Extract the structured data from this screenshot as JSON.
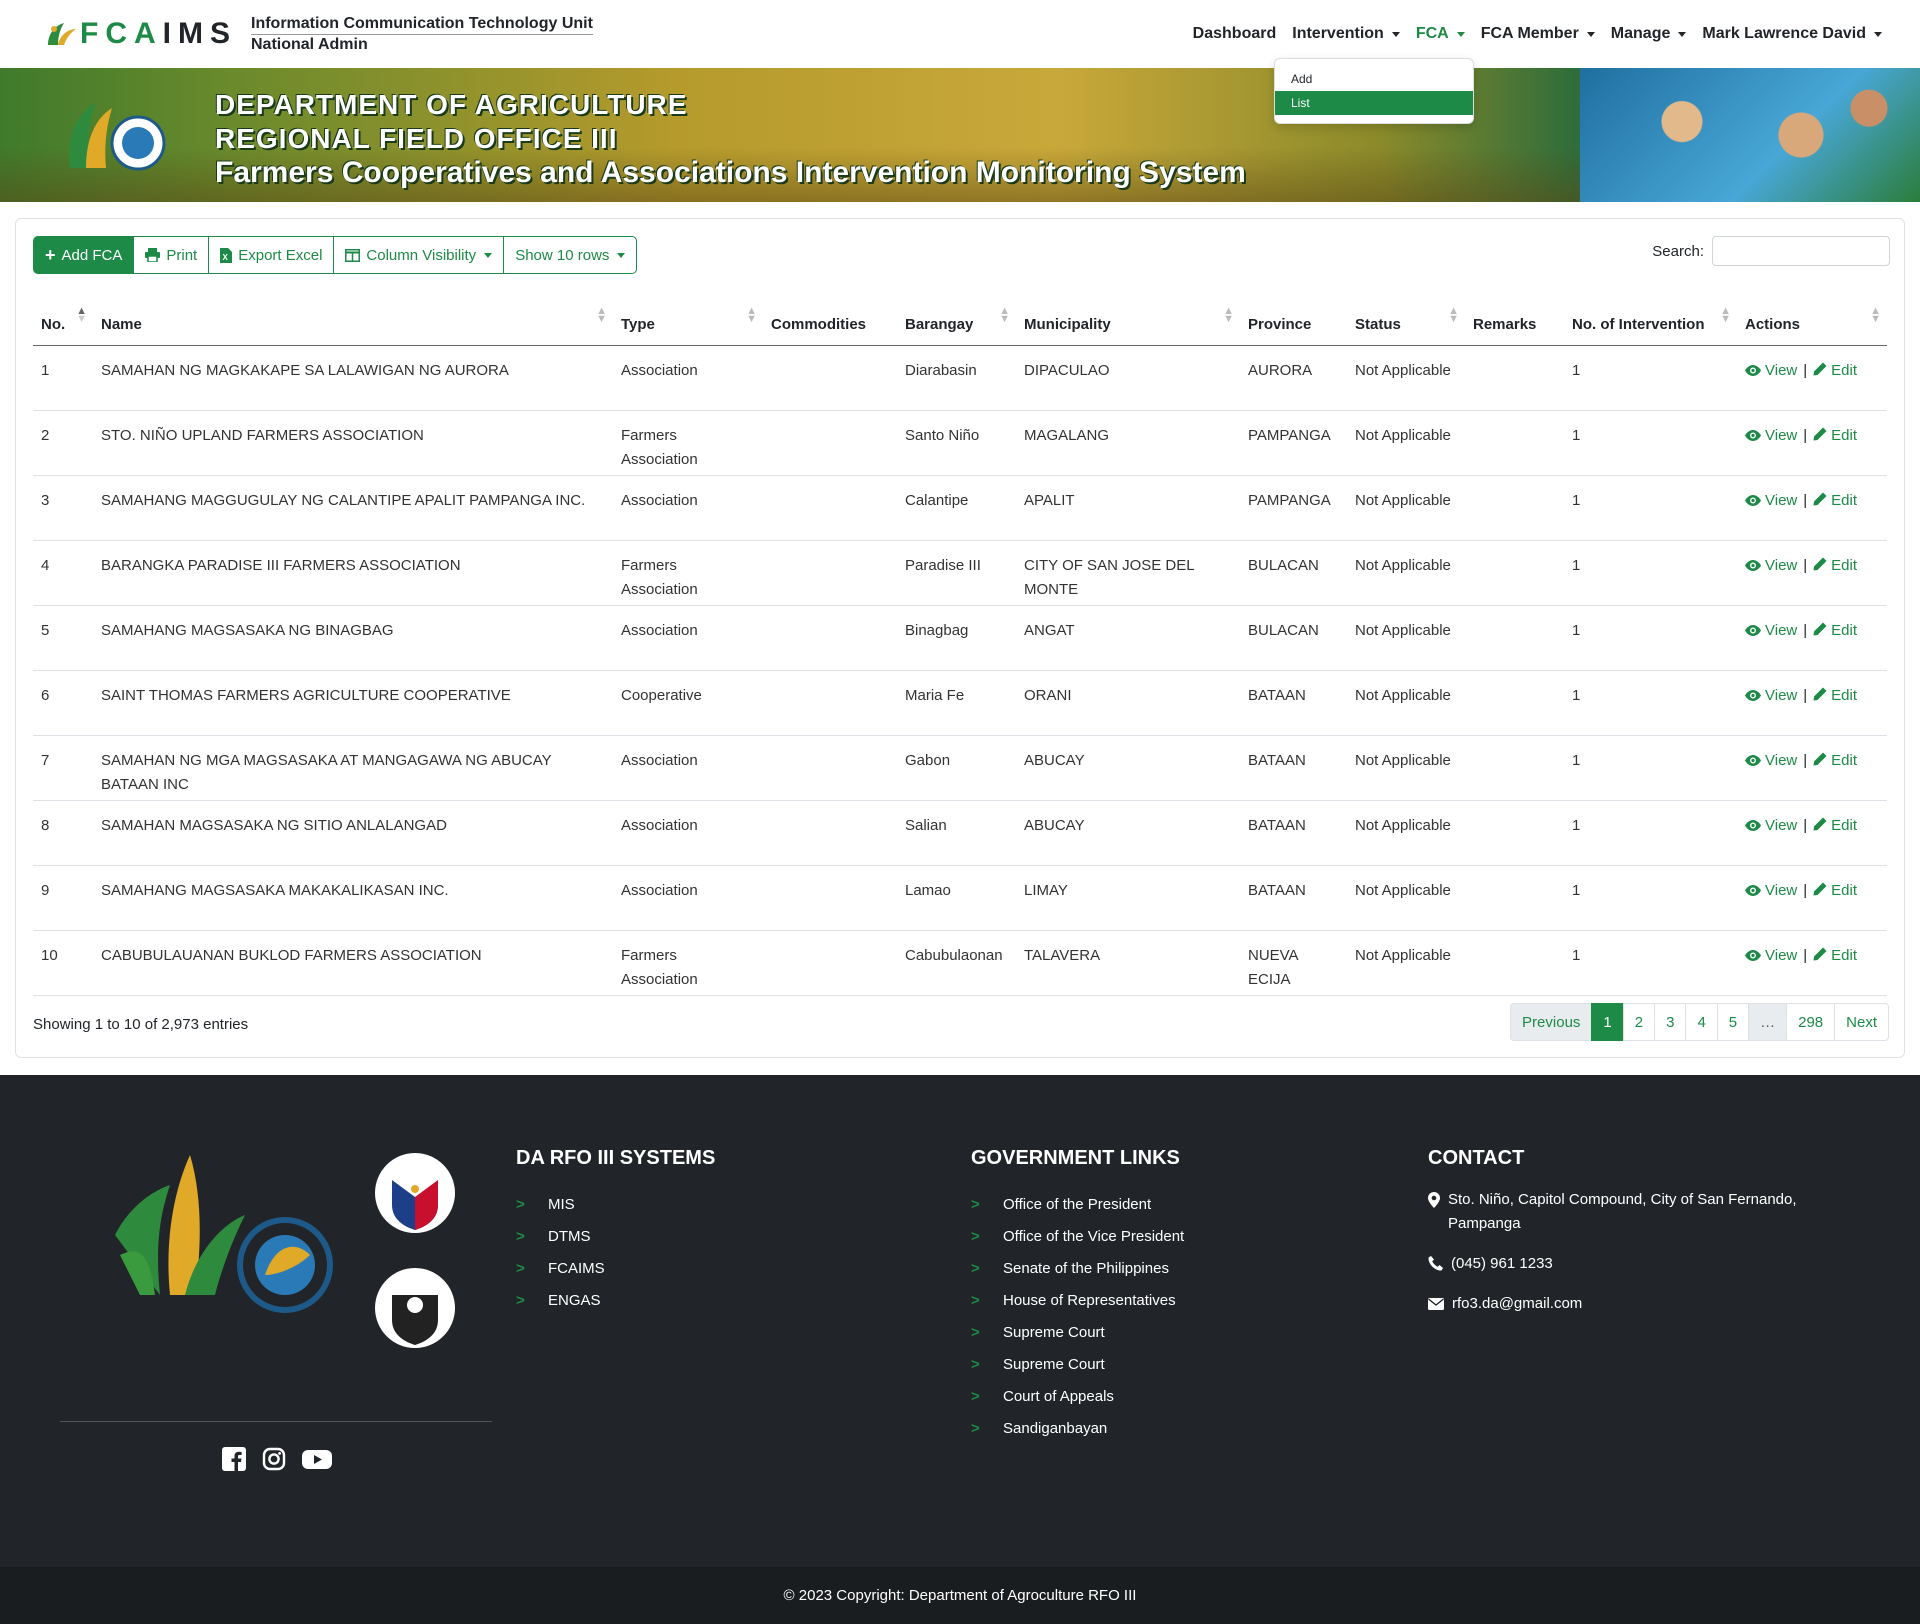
{
  "brand": {
    "name_fca": "FCA",
    "name_ims": "IMS",
    "unit": "Information Communication Technology Unit",
    "role": "National Admin"
  },
  "nav": {
    "items": [
      {
        "label": "Dashboard",
        "dropdown": false
      },
      {
        "label": "Intervention",
        "dropdown": true
      },
      {
        "label": "FCA",
        "dropdown": true,
        "active": true
      },
      {
        "label": "FCA Member",
        "dropdown": true
      },
      {
        "label": "Manage",
        "dropdown": true
      },
      {
        "label": "Mark Lawrence David",
        "dropdown": true
      }
    ],
    "fca_menu": [
      "Add",
      "List"
    ],
    "selected_menu": "List"
  },
  "banner": {
    "line1": "DEPARTMENT OF AGRICULTURE",
    "line2": "REGIONAL FIELD OFFICE III",
    "line3": "Farmers Cooperatives and Associations Intervention Monitoring System"
  },
  "toolbar": {
    "add_label": "Add FCA",
    "print_label": "Print",
    "export_label": "Export Excel",
    "columns_label": "Column Visibility",
    "rows_label": "Show 10 rows"
  },
  "search": {
    "label": "Search:",
    "value": ""
  },
  "table": {
    "headers": [
      "No.",
      "Name",
      "Type",
      "Commodities",
      "Barangay",
      "Municipality",
      "Province",
      "Status",
      "Remarks",
      "No. of Intervention",
      "Actions"
    ],
    "rows": [
      {
        "no": "1",
        "name": "SAMAHAN NG MAGKAKAPE SA LALAWIGAN NG AURORA",
        "type": "Association",
        "commodities": "",
        "barangay": "Diarabasin",
        "municipality": "DIPACULAO",
        "province": "AURORA",
        "status": "Not Applicable",
        "remarks": "",
        "interventions": "1"
      },
      {
        "no": "2",
        "name": "STO. NIÑO UPLAND FARMERS ASSOCIATION",
        "type": "Farmers Association",
        "commodities": "",
        "barangay": "Santo Niño",
        "municipality": "MAGALANG",
        "province": "PAMPANGA",
        "status": "Not Applicable",
        "remarks": "",
        "interventions": "1"
      },
      {
        "no": "3",
        "name": "SAMAHANG MAGGUGULAY NG CALANTIPE APALIT PAMPANGA INC.",
        "type": "Association",
        "commodities": "",
        "barangay": "Calantipe",
        "municipality": "APALIT",
        "province": "PAMPANGA",
        "status": "Not Applicable",
        "remarks": "",
        "interventions": "1"
      },
      {
        "no": "4",
        "name": "BARANGKA PARADISE III FARMERS ASSOCIATION",
        "type": "Farmers Association",
        "commodities": "",
        "barangay": "Paradise III",
        "municipality": "CITY OF SAN JOSE DEL MONTE",
        "province": "BULACAN",
        "status": "Not Applicable",
        "remarks": "",
        "interventions": "1"
      },
      {
        "no": "5",
        "name": "SAMAHANG MAGSASAKA NG BINAGBAG",
        "type": "Association",
        "commodities": "",
        "barangay": "Binagbag",
        "municipality": "ANGAT",
        "province": "BULACAN",
        "status": "Not Applicable",
        "remarks": "",
        "interventions": "1"
      },
      {
        "no": "6",
        "name": "SAINT THOMAS FARMERS AGRICULTURE COOPERATIVE",
        "type": "Cooperative",
        "commodities": "",
        "barangay": "Maria Fe",
        "municipality": "ORANI",
        "province": "BATAAN",
        "status": "Not Applicable",
        "remarks": "",
        "interventions": "1"
      },
      {
        "no": "7",
        "name": "SAMAHAN NG MGA MAGSASAKA AT MANGAGAWA NG ABUCAY BATAAN INC",
        "type": "Association",
        "commodities": "",
        "barangay": "Gabon",
        "municipality": "ABUCAY",
        "province": "BATAAN",
        "status": "Not Applicable",
        "remarks": "",
        "interventions": "1"
      },
      {
        "no": "8",
        "name": "SAMAHAN MAGSASAKA NG SITIO ANLALANGAD",
        "type": "Association",
        "commodities": "",
        "barangay": "Salian",
        "municipality": "ABUCAY",
        "province": "BATAAN",
        "status": "Not Applicable",
        "remarks": "",
        "interventions": "1"
      },
      {
        "no": "9",
        "name": "SAMAHANG MAGSASAKA MAKAKALIKASAN INC.",
        "type": "Association",
        "commodities": "",
        "barangay": "Lamao",
        "municipality": "LIMAY",
        "province": "BATAAN",
        "status": "Not Applicable",
        "remarks": "",
        "interventions": "1"
      },
      {
        "no": "10",
        "name": "CABUBULAUANAN BUKLOD FARMERS ASSOCIATION",
        "type": "Farmers Association",
        "commodities": "",
        "barangay": "Cabubulaonan",
        "municipality": "TALAVERA",
        "province": "NUEVA ECIJA",
        "status": "Not Applicable",
        "remarks": "",
        "interventions": "1"
      }
    ],
    "view_label": "View",
    "edit_label": "Edit"
  },
  "info": "Showing 1 to 10 of 2,973 entries",
  "pagination": {
    "previous": "Previous",
    "pages": [
      "1",
      "2",
      "3",
      "4",
      "5"
    ],
    "ellipsis": "…",
    "last": "298",
    "next": "Next",
    "current": "1"
  },
  "footer": {
    "systems_title": "DA RFO III SYSTEMS",
    "systems": [
      "MIS",
      "DTMS",
      "FCAIMS",
      "ENGAS"
    ],
    "gov_title": "GOVERNMENT LINKS",
    "gov_links": [
      "Office of the President",
      "Office of the Vice President",
      "Senate of the Philippines",
      "House of Representatives",
      "Supreme Court",
      "Supreme Court",
      "Court of Appeals",
      "Sandiganbayan"
    ],
    "contact_title": "CONTACT",
    "address": "Sto. Niño, Capitol Compound, City of San Fernando, Pampanga",
    "phone": "(045) 961 1233",
    "email": "rfo3.da@gmail.com",
    "copyright": "© 2023 Copyright: Department of Agroculture RFO III"
  },
  "colors": {
    "accent": "#1d8a47",
    "footer_bg": "#212529"
  }
}
